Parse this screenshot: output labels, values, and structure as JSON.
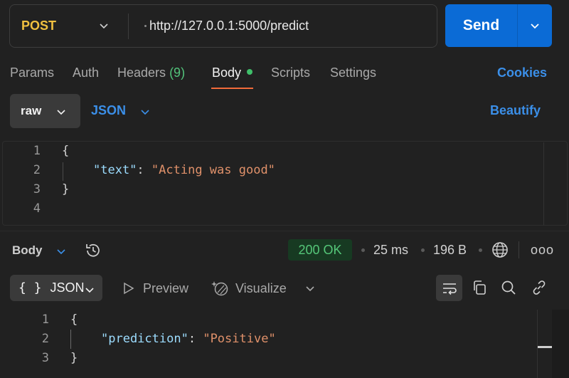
{
  "request": {
    "method": "POST",
    "url": "http://127.0.0.1:5000/predict",
    "send_label": "Send"
  },
  "tabs": [
    {
      "label": "Params"
    },
    {
      "label": "Auth"
    },
    {
      "label": "Headers",
      "count": "(9)"
    },
    {
      "label": "Body",
      "active": true
    },
    {
      "label": "Scripts"
    },
    {
      "label": "Settings"
    }
  ],
  "cookies_label": "Cookies",
  "body_options": {
    "mode": "raw",
    "format": "JSON",
    "beautify_label": "Beautify"
  },
  "request_body": {
    "lines": [
      {
        "n": "1",
        "open": "{"
      },
      {
        "n": "2",
        "key": "\"text\"",
        "colon": ":",
        "value": "\"Acting was good\""
      },
      {
        "n": "3",
        "close": "}"
      },
      {
        "n": "4"
      }
    ]
  },
  "response": {
    "section_label": "Body",
    "status": "200 OK",
    "time": "25 ms",
    "size": "196 B",
    "more": "ooo",
    "view_format": "JSON",
    "view_format_braces": "{ }",
    "preview_label": "Preview",
    "visualize_label": "Visualize",
    "lines": [
      {
        "n": "1",
        "open": "{"
      },
      {
        "n": "2",
        "key": "\"prediction\"",
        "colon": ":",
        "value": "\"Positive\""
      },
      {
        "n": "3",
        "close": "}"
      }
    ]
  },
  "colors": {
    "accent_blue": "#0b6bd6",
    "method_yellow": "#f0c040",
    "active_tab_underline": "#f26b3a",
    "status_green": "#55c779"
  },
  "icons": [
    "chevron-down-icon",
    "history-icon",
    "globe-icon",
    "more-icon",
    "play-icon",
    "visualize-icon",
    "wrap-icon",
    "copy-icon",
    "search-icon",
    "link-icon"
  ]
}
